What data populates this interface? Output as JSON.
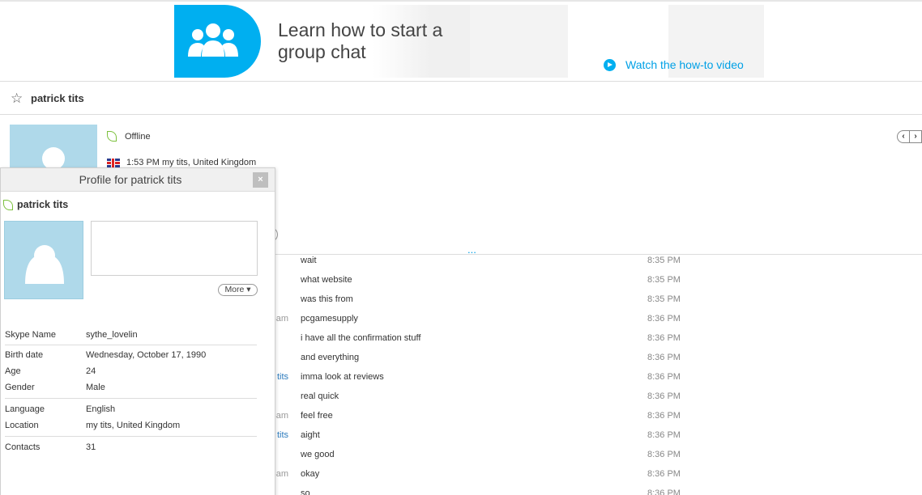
{
  "banner": {
    "headline_line1": "Learn how to start a",
    "headline_line2": "group chat",
    "link_text": "Watch the how-to video",
    "accent_color": "#00aff0",
    "icon": "group-people-icon"
  },
  "header": {
    "contact_name": "patrick tits",
    "status": "Offline",
    "local_info": "1:53 PM my tits, United Kingdom",
    "nav_prev": "‹",
    "nav_next": "›"
  },
  "chat": {
    "more_indicator": "...",
    "messages": [
      {
        "sender": "",
        "text": "wait",
        "time": "8:35 PM",
        "is_me": false
      },
      {
        "sender": "",
        "text": "what website",
        "time": "8:35 PM",
        "is_me": false
      },
      {
        "sender": "",
        "text": "was this from",
        "time": "8:35 PM",
        "is_me": false
      },
      {
        "sender": "Sam",
        "text": "pcgamesupply",
        "time": "8:36 PM",
        "is_me": false
      },
      {
        "sender": "",
        "text": "i have all the confirmation stuff",
        "time": "8:36 PM",
        "is_me": false
      },
      {
        "sender": "",
        "text": "and everything",
        "time": "8:36 PM",
        "is_me": false
      },
      {
        "sender": "tits",
        "text": "imma look at reviews",
        "time": "8:36 PM",
        "is_me": true
      },
      {
        "sender": "",
        "text": "real quick",
        "time": "8:36 PM",
        "is_me": true
      },
      {
        "sender": "Sam",
        "text": "feel free",
        "time": "8:36 PM",
        "is_me": false
      },
      {
        "sender": "tits",
        "text": "aight",
        "time": "8:36 PM",
        "is_me": true
      },
      {
        "sender": "",
        "text": "we good",
        "time": "8:36 PM",
        "is_me": true
      },
      {
        "sender": "Sam",
        "text": "okay",
        "time": "8:36 PM",
        "is_me": false
      },
      {
        "sender": "",
        "text": "so",
        "time": "8:36 PM",
        "is_me": false
      }
    ]
  },
  "profile": {
    "title": "Profile for patrick tits",
    "close_label": "×",
    "name": "patrick tits",
    "more_label": "More ▾",
    "details": {
      "skype_name_label": "Skype Name",
      "skype_name": "sythe_lovelin",
      "birth_date_label": "Birth date",
      "birth_date": "Wednesday, October 17, 1990",
      "age_label": "Age",
      "age": "24",
      "gender_label": "Gender",
      "gender": "Male",
      "language_label": "Language",
      "language": "English",
      "location_label": "Location",
      "location": "my tits, United Kingdom",
      "contacts_label": "Contacts",
      "contacts": "31"
    }
  }
}
